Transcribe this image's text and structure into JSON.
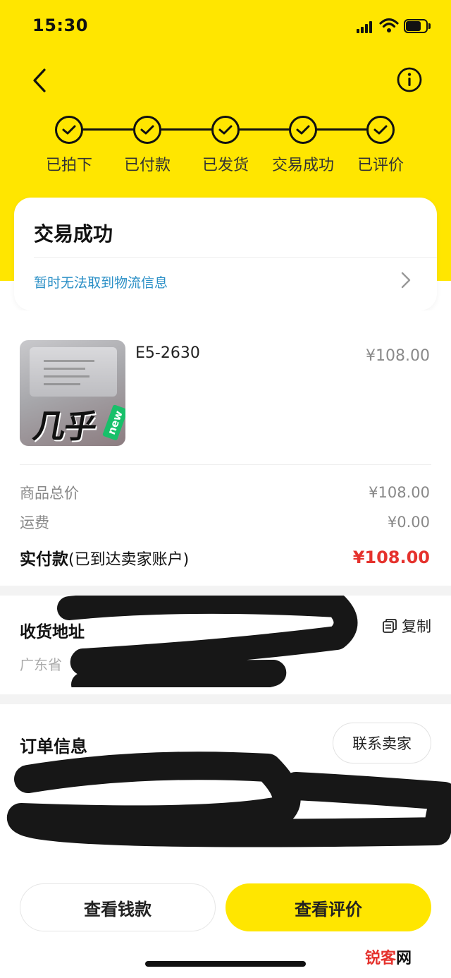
{
  "status_bar": {
    "time": "15:30",
    "battery_level": 0.75
  },
  "header": {
    "back_icon": "chevron-left-icon",
    "info_icon": "info-circle-icon"
  },
  "progress_steps": [
    {
      "label": "已拍下",
      "done": true
    },
    {
      "label": "已付款",
      "done": true
    },
    {
      "label": "已发货",
      "done": true
    },
    {
      "label": "交易成功",
      "done": true
    },
    {
      "label": "已评价",
      "done": true
    }
  ],
  "status_card": {
    "title": "交易成功",
    "logistics_text": "暂时无法取到物流信息"
  },
  "product": {
    "thumb_text": "几乎",
    "thumb_badge": "new",
    "name": "E5-2630",
    "price": "¥108.00"
  },
  "fees": {
    "goods_total_label": "商品总价",
    "goods_total_value": "¥108.00",
    "shipping_label": "运费",
    "shipping_value": "¥0.00",
    "paid_label": "实付款",
    "paid_note": "(已到达卖家账户)",
    "paid_value": "¥108.00"
  },
  "address": {
    "label": "收货地址",
    "copy_label": "复制",
    "detail": "广东省"
  },
  "order": {
    "label": "订单信息",
    "contact_label": "联系卖家"
  },
  "actions": {
    "view_money": "查看钱款",
    "view_review": "查看评价"
  },
  "watermark": {
    "red": "锐客",
    "black": "网"
  },
  "colors": {
    "brand_yellow": "#FFE600",
    "price_red": "#E5322D",
    "link_blue": "#2A8FC6"
  }
}
